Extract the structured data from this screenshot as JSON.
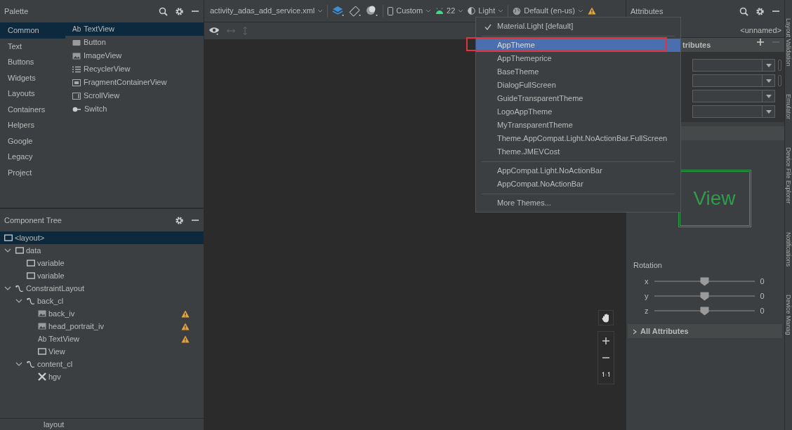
{
  "palette": {
    "title": "Palette",
    "categories": [
      {
        "label": "Common",
        "selected": true
      },
      {
        "label": "Text",
        "selected": false
      },
      {
        "label": "Buttons",
        "selected": false
      },
      {
        "label": "Widgets",
        "selected": false
      },
      {
        "label": "Layouts",
        "selected": false
      },
      {
        "label": "Containers",
        "selected": false
      },
      {
        "label": "Helpers",
        "selected": false
      },
      {
        "label": "Google",
        "selected": false
      },
      {
        "label": "Legacy",
        "selected": false
      },
      {
        "label": "Project",
        "selected": false
      }
    ],
    "items": [
      {
        "label": "TextView",
        "kind": "text",
        "glyph": "Ab",
        "selected": true
      },
      {
        "label": "Button",
        "kind": "button",
        "selected": false
      },
      {
        "label": "ImageView",
        "kind": "image",
        "selected": false
      },
      {
        "label": "RecyclerView",
        "kind": "list",
        "selected": false
      },
      {
        "label": "FragmentContainerView",
        "kind": "fragment",
        "selected": false
      },
      {
        "label": "ScrollView",
        "kind": "scroll",
        "selected": false
      },
      {
        "label": "Switch",
        "kind": "switch",
        "selected": false
      }
    ]
  },
  "toolbar": {
    "file": "activity_adas_add_service.xml",
    "device": "Custom",
    "api": "22",
    "theme": "Light",
    "locale": "Default (en-us)"
  },
  "theme_menu": {
    "items": [
      {
        "kind": "item",
        "label": "Material.Light [default]",
        "checked": true,
        "selected": false,
        "framed": false
      },
      {
        "kind": "separator"
      },
      {
        "kind": "item",
        "label": "AppTheme",
        "checked": false,
        "selected": true,
        "framed": true
      },
      {
        "kind": "item",
        "label": "AppThemeprice",
        "checked": false,
        "selected": false,
        "framed": false
      },
      {
        "kind": "item",
        "label": "BaseTheme",
        "checked": false,
        "selected": false,
        "framed": false
      },
      {
        "kind": "item",
        "label": "DialogFullScreen",
        "checked": false,
        "selected": false,
        "framed": false
      },
      {
        "kind": "item",
        "label": "GuideTransparentTheme",
        "checked": false,
        "selected": false,
        "framed": false
      },
      {
        "kind": "item",
        "label": "LogoAppTheme",
        "checked": false,
        "selected": false,
        "framed": false
      },
      {
        "kind": "item",
        "label": "MyTransparentTheme",
        "checked": false,
        "selected": false,
        "framed": false
      },
      {
        "kind": "item",
        "label": "Theme.AppCompat.Light.NoActionBar.FullScreen",
        "checked": false,
        "selected": false,
        "framed": false
      },
      {
        "kind": "item",
        "label": "Theme.JMEVCost",
        "checked": false,
        "selected": false,
        "framed": false
      },
      {
        "kind": "separator"
      },
      {
        "kind": "item",
        "label": "AppCompat.Light.NoActionBar",
        "checked": false,
        "selected": false,
        "framed": false
      },
      {
        "kind": "item",
        "label": "AppCompat.NoActionBar",
        "checked": false,
        "selected": false,
        "framed": false
      },
      {
        "kind": "separator"
      },
      {
        "kind": "item",
        "label": "More Themes...",
        "checked": false,
        "selected": false,
        "framed": false
      }
    ]
  },
  "component_tree": {
    "title": "Component Tree",
    "items": [
      {
        "label": "<layout>",
        "kind": "box",
        "selected": true,
        "warning": false
      },
      {
        "label": "data",
        "kind": "box",
        "selected": false,
        "warning": false,
        "expanded": true,
        "children": [
          {
            "label": "variable",
            "kind": "box",
            "selected": false,
            "warning": false
          },
          {
            "label": "variable",
            "kind": "box",
            "selected": false,
            "warning": false
          }
        ]
      },
      {
        "label": "ConstraintLayout",
        "kind": "constraint",
        "selected": false,
        "warning": false,
        "expanded": true,
        "children": [
          {
            "label": "back_cl",
            "kind": "constraint",
            "selected": false,
            "warning": false,
            "expanded": true,
            "children": [
              {
                "label": "back_iv",
                "kind": "image",
                "selected": false,
                "warning": true
              },
              {
                "label": "head_portrait_iv",
                "kind": "image",
                "selected": false,
                "warning": true
              },
              {
                "label": "TextView",
                "kind": "text",
                "glyph": "Ab",
                "selected": false,
                "warning": true
              },
              {
                "label": "View",
                "kind": "box",
                "selected": false,
                "warning": false
              }
            ]
          },
          {
            "label": "content_cl",
            "kind": "constraint",
            "selected": false,
            "warning": false,
            "expanded": true,
            "children": [
              {
                "label": "hgv",
                "kind": "tools",
                "selected": false,
                "warning": false
              }
            ]
          }
        ]
      }
    ]
  },
  "status_bar": {
    "text": "layout"
  },
  "attributes": {
    "title": "Attributes",
    "component": "<unnamed>",
    "section": "tributes",
    "fields": [
      {
        "toggle": true
      },
      {
        "toggle": true
      },
      {
        "toggle": false
      },
      {
        "toggle": false
      }
    ],
    "preview": "View",
    "rotation": {
      "label": "Rotation",
      "axes": [
        {
          "axis": "x",
          "level": 0.5,
          "reading": "0"
        },
        {
          "axis": "y",
          "level": 0.5,
          "reading": "0"
        },
        {
          "axis": "z",
          "level": 0.5,
          "reading": "0"
        }
      ]
    },
    "all_attributes": {
      "label": "All Attributes",
      "expanded": false
    }
  },
  "side_tabs": [
    "Layout Validation",
    "Emulator",
    "Device File Explorer",
    "Notifications",
    "Device Manag"
  ]
}
